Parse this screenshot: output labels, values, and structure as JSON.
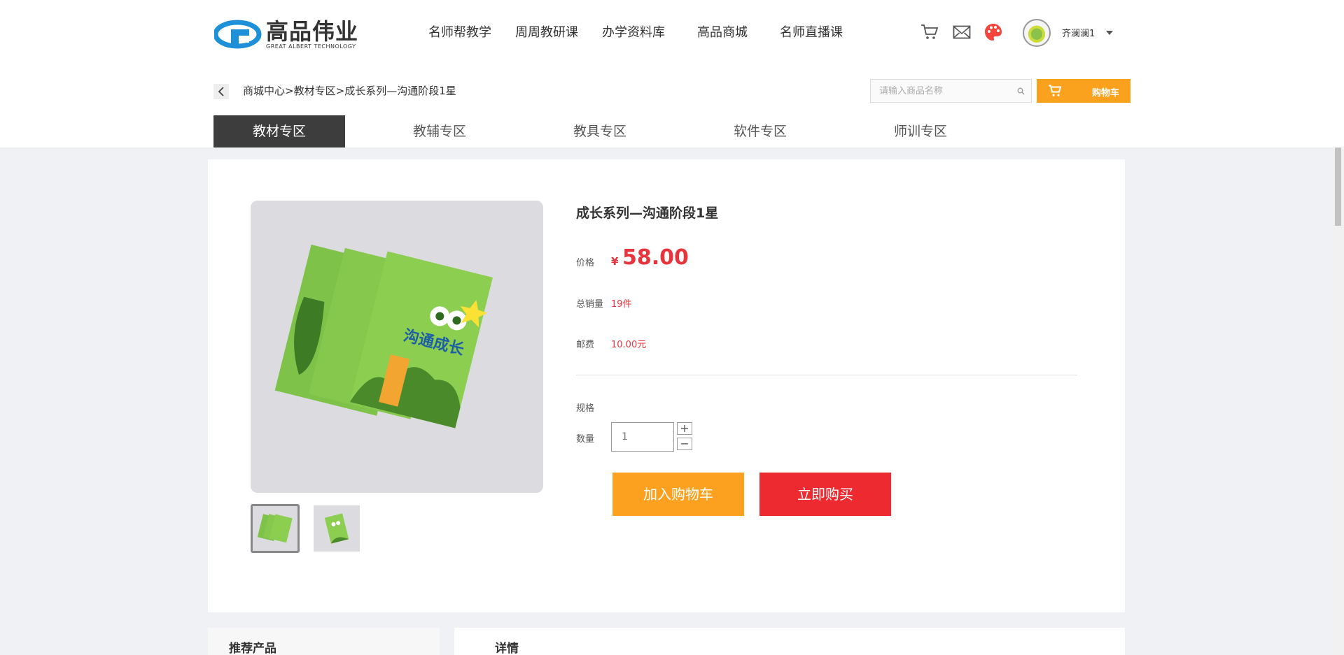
{
  "brand": {
    "name_cn": "高品伟业",
    "name_en": "GREAT ALBERT TECHNOLOGY",
    "color": "#1e90d8"
  },
  "nav": [
    "名师帮教学",
    "周周教研课",
    "办学资料库",
    "高品商城",
    "名师直播课"
  ],
  "header_icons": [
    "cart-icon",
    "mail-icon",
    "palette-icon"
  ],
  "user": {
    "name": "齐澜澜1"
  },
  "breadcrumb": {
    "items": [
      "商城中心",
      "教材专区",
      "成长系列—沟通阶段1星"
    ],
    "separator": ">"
  },
  "search": {
    "placeholder": "请输入商品名称"
  },
  "cart_button": {
    "label": "购物车",
    "color": "#faa21e"
  },
  "tabs": [
    "教材专区",
    "教辅专区",
    "教具专区",
    "软件专区",
    "师训专区"
  ],
  "product": {
    "title": "成长系列—沟通阶段1星",
    "price_label": "价格",
    "currency": "¥",
    "price": "58.00",
    "sales_label": "总销量",
    "sales": "19件",
    "shipping_label": "邮费",
    "shipping": "10.00元",
    "spec_label": "规格",
    "qty_label": "数量",
    "qty": "1",
    "add_to_cart": "加入购物车",
    "buy_now": "立即购买",
    "accent": "#e8343c",
    "cover_text": "沟通成长"
  },
  "recommended_title": "推荐产品",
  "detail_title": "详情"
}
